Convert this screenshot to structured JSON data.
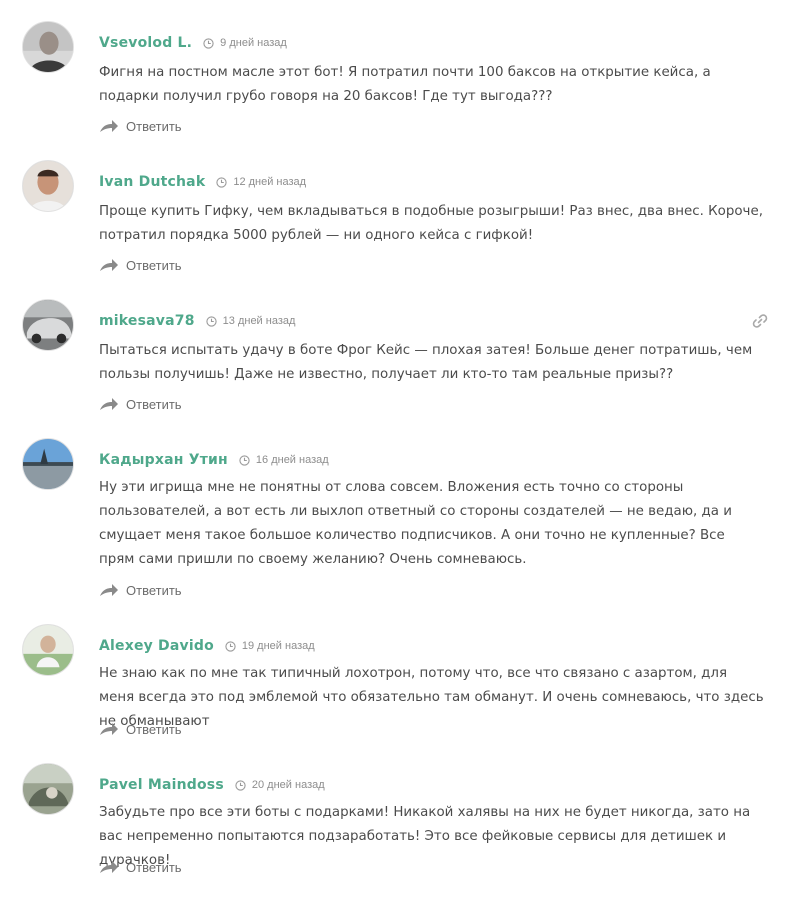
{
  "comments": [
    {
      "author": "Vsevolod L.",
      "time": "9 дней назад",
      "text": "Фигня на постном масле этот бот! Я потратил почти 100 баксов на открытие кейса, а подарки получил грубо говоря на 20 баксов! Где тут выгода???",
      "reply_label": "Ответить",
      "avatar_icon": "avatar-photo"
    },
    {
      "author": "Ivan Dutchak",
      "time": "12 дней назад",
      "text": "Проще купить Гифку, чем вкладываться в подобные розыгрыши! Раз внес, два внес. Короче, потратил порядка 5000 рублей — ни одного кейса с гифкой!",
      "reply_label": "Ответить",
      "avatar_icon": "avatar-photo"
    },
    {
      "author": "mikesava78",
      "time": "13 дней назад",
      "text": "Пытаться испытать удачу в боте Фрог Кейс — плохая затея! Больше денег потратишь, чем пользы получишь! Даже не известно, получает ли кто-то там реальные призы??",
      "reply_label": "Ответить",
      "avatar_icon": "avatar-photo",
      "permalink_icon": "link-icon"
    },
    {
      "author": "Кадырхан Утин",
      "time": "16 дней назад",
      "text": "Ну эти игрища мне не понятны от слова совсем. Вложения есть точно со стороны пользователей, а вот есть ли выхлоп ответный со стороны создателей — не ведаю, да и смущает меня такое большое количество подписчиков. А они точно не купленные? Все прям сами пришли по своему желанию? Очень сомневаюсь.",
      "reply_label": "Ответить",
      "avatar_icon": "avatar-photo"
    },
    {
      "author": "Alexey Davido",
      "time": "19 дней назад",
      "text": "Не знаю как по мне так типичный лохотрон, потому что, все что связано с азартом, для меня всегда это под эмблемой что обязательно там обманут. И очень сомневаюсь, что здесь не обманывают",
      "reply_label": "Ответить",
      "avatar_icon": "avatar-photo"
    },
    {
      "author": "Pavel Maindoss",
      "time": "20 дней назад",
      "text": "Забудьте про все эти боты с подарками! Никакой халявы на них не будет никогда, зато на вас непременно попытаются подзаработать! Это все фейковые сервисы для детишек и дурачков!",
      "reply_label": "Ответить",
      "avatar_icon": "avatar-photo"
    }
  ],
  "colors": {
    "author": "#4fa88b",
    "text": "#4b4b4b",
    "meta": "#8d8d8d"
  }
}
